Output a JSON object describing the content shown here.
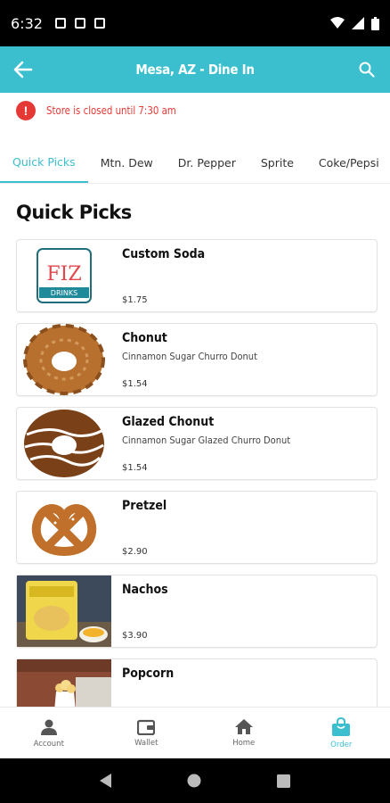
{
  "status_bar": {
    "time": "6:32"
  },
  "app_bar": {
    "title": "Mesa, AZ - Dine In"
  },
  "notice": {
    "text": "Store is closed until 7:30 am"
  },
  "tabs": [
    {
      "label": "Quick Picks",
      "active": true
    },
    {
      "label": "Mtn. Dew",
      "active": false
    },
    {
      "label": "Dr. Pepper",
      "active": false
    },
    {
      "label": "Sprite",
      "active": false
    },
    {
      "label": "Coke/Pepsi",
      "active": false
    }
  ],
  "section": {
    "title": "Quick Picks"
  },
  "items": [
    {
      "name": "Custom Soda",
      "description": "",
      "price": "$1.75",
      "logo_text_top": "FIZ",
      "logo_text_bottom": "DRINKS"
    },
    {
      "name": "Chonut",
      "description": "Cinnamon Sugar Churro Donut",
      "price": "$1.54"
    },
    {
      "name": "Glazed Chonut",
      "description": "Cinnamon Sugar Glazed Churro Donut",
      "price": "$1.54"
    },
    {
      "name": "Pretzel",
      "description": "",
      "price": "$2.90"
    },
    {
      "name": "Nachos",
      "description": "",
      "price": "$3.90"
    },
    {
      "name": "Popcorn",
      "description": "",
      "price": ""
    }
  ],
  "bottom_nav": [
    {
      "label": "Account",
      "icon": "account-icon",
      "active": false
    },
    {
      "label": "Wallet",
      "icon": "wallet-icon",
      "active": false
    },
    {
      "label": "Home",
      "icon": "home-icon",
      "active": false
    },
    {
      "label": "Order",
      "icon": "order-bag-icon",
      "active": true
    }
  ],
  "colors": {
    "accent": "#3bbfcf",
    "alert": "#e53935"
  }
}
